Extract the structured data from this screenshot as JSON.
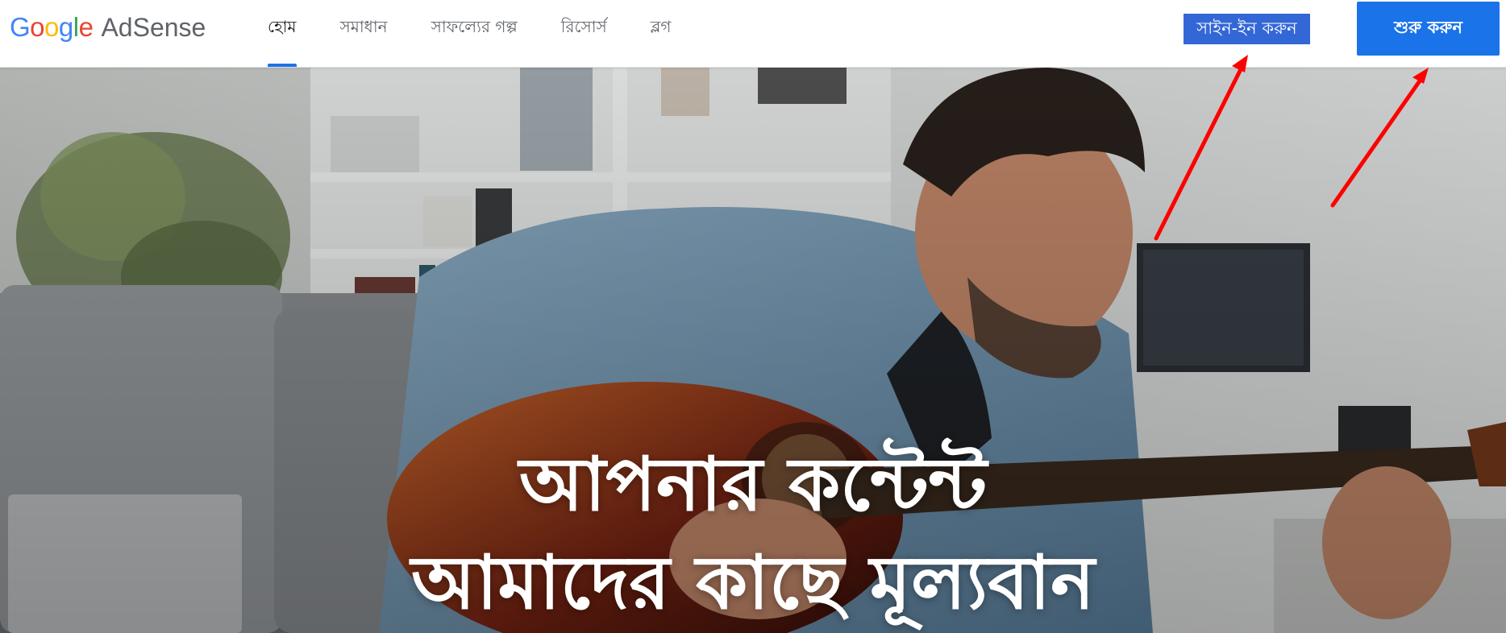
{
  "header": {
    "logo": {
      "brand_letters": [
        "G",
        "o",
        "o",
        "g",
        "l",
        "e"
      ],
      "brand_colors": [
        "#4285F4",
        "#EA4335",
        "#FBBC05",
        "#4285F4",
        "#34A853",
        "#EA4335"
      ],
      "product": "AdSense"
    },
    "nav": {
      "items": [
        {
          "label": "হোম",
          "active": true
        },
        {
          "label": "সমাধান",
          "active": false
        },
        {
          "label": "সাফল্যের গল্প",
          "active": false
        },
        {
          "label": "রিসোর্স",
          "active": false
        },
        {
          "label": "ব্লগ",
          "active": false
        }
      ]
    },
    "signin_label": "সাইন-ইন করুন",
    "start_label": "শুরু করুন"
  },
  "hero": {
    "title_line1": "আপনার কন্টেন্ট",
    "title_line2": "আমাদের কাছে মূল্যবান"
  },
  "colors": {
    "accent": "#1a73e8",
    "signin_highlight": "#3367d6",
    "annotation_arrow": "#ff0000"
  }
}
